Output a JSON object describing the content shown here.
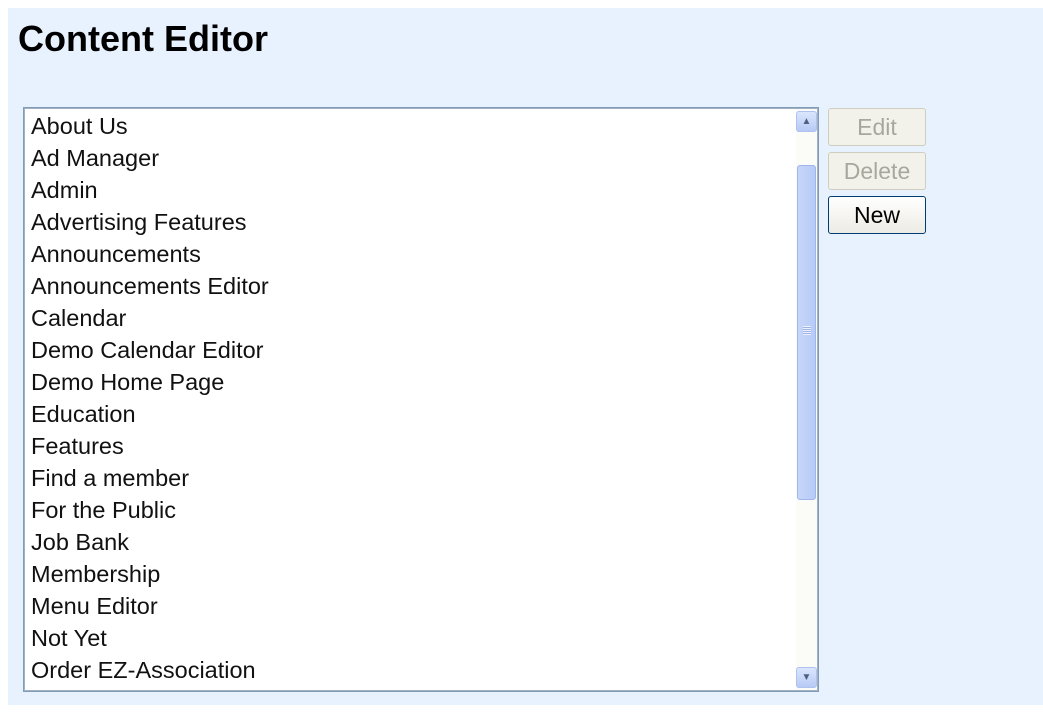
{
  "page": {
    "title": "Content Editor"
  },
  "content_list": {
    "items": [
      "About Us",
      "Ad Manager",
      "Admin",
      "Advertising Features",
      "Announcements",
      "Announcements Editor",
      "Calendar",
      "Demo Calendar Editor",
      "Demo Home Page",
      "Education",
      "Features",
      "Find a member",
      "For the Public",
      "Job Bank",
      "Membership",
      "Menu Editor",
      "Not Yet",
      "Order EZ-Association"
    ]
  },
  "actions": {
    "edit_label": "Edit",
    "delete_label": "Delete",
    "new_label": "New",
    "edit_enabled": false,
    "delete_enabled": false,
    "new_enabled": true
  },
  "scrollbar": {
    "icons": {
      "up": "chevron-up-icon",
      "down": "chevron-down-icon"
    }
  },
  "colors": {
    "panel_background": "#e8f1fe",
    "listbox_border": "#7f9db9",
    "scroll_thumb": "#c1d3fb"
  }
}
